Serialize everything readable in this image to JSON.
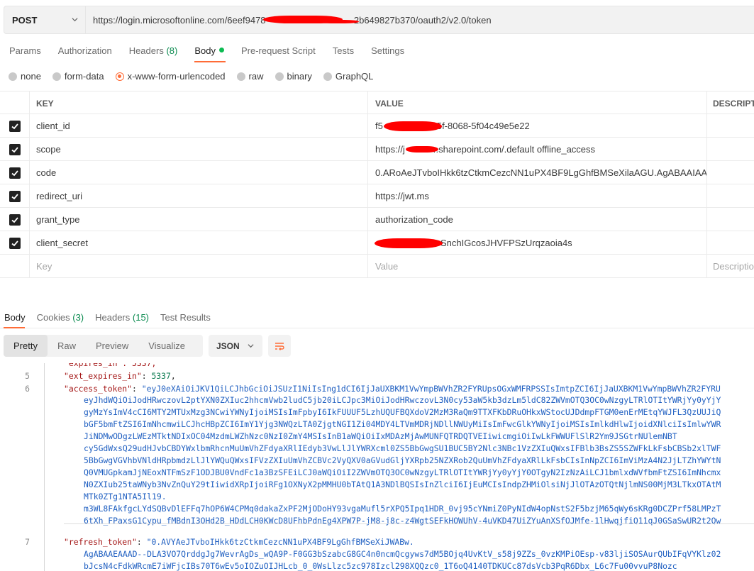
{
  "request": {
    "method": "POST",
    "url_prefix": "https://login.microsoftonline.com/6eef9478",
    "url_suffix": "-2b649827b370/oauth2/v2.0/token"
  },
  "request_tabs": [
    {
      "label": "Params"
    },
    {
      "label": "Authorization"
    },
    {
      "label": "Headers",
      "count": "(8)"
    },
    {
      "label": "Body",
      "active": true
    },
    {
      "label": "Pre-request Script"
    },
    {
      "label": "Tests"
    },
    {
      "label": "Settings"
    }
  ],
  "body_types": [
    "none",
    "form-data",
    "x-www-form-urlencoded",
    "raw",
    "binary",
    "GraphQL"
  ],
  "body_type_selected": "x-www-form-urlencoded",
  "table": {
    "headers": {
      "key": "KEY",
      "value": "VALUE",
      "description": "DESCRIPT"
    },
    "rows": [
      {
        "key": "client_id",
        "value": "5f-8068-5f04c49e5e22",
        "value_prefix": "f5"
      },
      {
        "key": "scope",
        "value_prefix": "https://j",
        "value": "r.sharepoint.com/.default offline_access"
      },
      {
        "key": "code",
        "value_prefix": "",
        "value": "0.ARoAeJTvboIHkk6tzCtkmCezcNN1uPX4BF9LgGhfBMSeXilaAGU.AgABAAIAAA..."
      },
      {
        "key": "redirect_uri",
        "value_prefix": "",
        "value": "https://jwt.ms"
      },
      {
        "key": "grant_type",
        "value_prefix": "",
        "value": "authorization_code"
      },
      {
        "key": "client_secret",
        "value_prefix": "",
        "value": "SnchIGcosJHVFPSzUrqzaoia4s"
      }
    ],
    "placeholders": {
      "key": "Key",
      "value": "Value",
      "description": "Descriptio"
    }
  },
  "response_tabs": [
    {
      "label": "Body",
      "active": true
    },
    {
      "label": "Cookies",
      "count": "(3)"
    },
    {
      "label": "Headers",
      "count": "(15)"
    },
    {
      "label": "Test Results"
    }
  ],
  "view_modes": [
    "Pretty",
    "Raw",
    "Preview",
    "Visualize"
  ],
  "view_mode_selected": "Pretty",
  "format": "JSON",
  "code": {
    "top_partial": "\"expires_in\": 5337,",
    "lines": [
      {
        "num": "5",
        "key": "\"ext_expires_in\"",
        "value": "5337"
      },
      {
        "num": "6",
        "key": "\"access_token\"",
        "value": "\"eyJ0eXAiOiJKV1QiLCJhbGciOiJSUzI1NiIsIng1dCI6IjJaUXBKM1VwYmpBWVhZR2FYRUpsOGxWMFRPSSIsImtpZCI6IjJaUXBKM1VwYmpBWVhZR2FYRU"
      },
      {
        "num": "7",
        "key": "\"refresh_token\"",
        "value": "\"0.AVYAeJTvboIHkk6tzCtkmCezcNN1uPX4BF9LgGhfBMSeXiJWABw."
      }
    ],
    "access_wrap": [
      "eyJhdWQiOiJodHRwczovL2ptYXN0ZXIuc2hhcmVwb2ludC5jb20iLCJpc3MiOiJodHRwczovL3N0cy53aW5kb3dzLm5ldC82ZWVmOTQ3OC0wNzgyLTRlOTItYWRjYy0yYjY",
      "gyMzYsImV4cCI6MTY2MTUxMzg3NCwiYWNyIjoiMSIsImFpbyI6IkFUUUF5LzhUQUFBQXdoV2MzM3RaQm9TTXFKbDRuOHkxWStocUJDdmpFTGM0enErMEtqYWJFL3QzUUJiQ",
      "bGF5bmFtZSI6ImNhcmwiLCJhcHBpZCI6ImY1Yjg3NWQzLTA0ZjgtNGI1Zi04MDY4LTVmMDRjNDllNWUyMiIsImFwcGlkYWNyIjoiMSIsImlkdHlwIjoidXNlciIsImlwYWR",
      "JiNDMwODgzLWEzMTktNDIxOC04MzdmLWZhNzc0NzI0ZmY4MSIsInB1aWQiOiIxMDAzMjAwMUNFQTRDQTVEIiwicmgiOiIwLkFWWUFlSlR2Ym9JSGtrNUlemNBT",
      "cy5GdWxsQ29udHJvbCBDYWxlbmRhcnMuUmVhZFdyaXRlIEdyb3VwLlJlYWRXcml0ZS5BbGwgSU1BUC5BY2Nlc3NBc1VzZXIuQWxsIFBlb3BsZS5SZWFkLkFsbCBSb2xlTWF",
      "5BbGwgVGVhbVNldHRpbmdzLlJlYWQuQWxsIFVzZXIuUmVhZCBVc2VyQXV0aGVudGljYXRpb25NZXRob2QuUmVhZFdyaXRlLkFsbCIsInNpZCI6ImViMzA4N2JjLTZhYWYtN",
      "Q0VMUGpkamJjNEoxNTFmSzF1ODJBU0VndFc1a3BzSFEiLCJ0aWQiOiI2ZWVmOTQ3OC0wNzgyLTRlOTItYWRjYy0yYjY0OTgyN2IzNzAiLCJ1bmlxdWVfbmFtZSI6ImNhcmx",
      "N0ZXIub25taWNyb3NvZnQuY29tIiwidXRpIjoiRFg1OXNyX2pMMHU0bTAtQ1A3NDlBQSIsInZlciI6IjEuMCIsIndpZHMiOlsiNjJlOTAzOTQtNjlmNS00MjM3LTkxOTAtM",
      "MTk0ZTg1NTA5Il19.",
      "m3WL8FAkfgcLYdSQBvDlEFFq7hOP6W4CPMq0dakaZxPF2MjODoHY93vgaMufl5rXPQ5Ipq1HDR_0vj95cYNmiZ0PyNIdW4opNstS2F5bzjM65qWy6sKRg0DCZPrf58LMPzT",
      "6tXh_FPaxsG1Cypu_fMBdnI3OHd2B_HDdLCH0KWcD8UFhbPdnEg4XPW7P-jM8-j8c-z4WgtSEFkHOWUhV-4uVKD47UiZYuAnXSfOJMfe-1lHwqjfiQ11qJ0GSaSwUR2t2Qw"
    ],
    "refresh_wrap": [
      "AgABAAEAAAD--DLA3VO7QrddgJg7WevrAgDs_wQA9P-F0GG3bSzabcG8GC4n0ncmQcgyws7dM5BOjq4UvKtV_s58j9ZZs_0vzKMPiOEsp-v83ljiSOSAurQUbIFqVYKlz02",
      "bJcsN4cFdkWRcmE7iWFjcIBs70T6wEv5oIOZuOIJHLcb_0_0WsLlzc5zc978Izcl298XQQzc0_1T6oQ4140TDKUCc87dsVcb3PqR6Dbx_L6c7Fu00vvuP8Nozc"
    ]
  }
}
